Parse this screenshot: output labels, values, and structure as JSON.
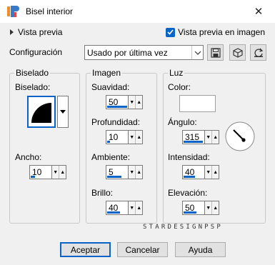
{
  "window": {
    "title": "Bisel interior",
    "close_glyph": "✕"
  },
  "top": {
    "preview_label": "Vista previa",
    "live_preview_label": "Vista previa en imagen",
    "live_preview_checked": true
  },
  "config": {
    "label": "Configuración",
    "value": "Usado por última vez"
  },
  "groups": {
    "bevel": {
      "title": "Biselado",
      "bevel_label": "Biselado:",
      "width_label": "Ancho:",
      "width_value": "10"
    },
    "image": {
      "title": "Imagen",
      "smoothness_label": "Suavidad:",
      "smoothness_value": "50",
      "depth_label": "Profundidad:",
      "depth_value": "10",
      "ambience_label": "Ambiente:",
      "ambience_value": "5",
      "brightness_label": "Brillo:",
      "brightness_value": "40"
    },
    "light": {
      "title": "Luz",
      "color_label": "Color:",
      "color_value": "#ffffff",
      "angle_label": "Ángulo:",
      "angle_value": "315",
      "intensity_label": "Intensidad:",
      "intensity_value": "40",
      "elevation_label": "Elevación:",
      "elevation_value": "50"
    }
  },
  "watermark": "STARDESIGNPSP",
  "buttons": {
    "accept": "Aceptar",
    "cancel": "Cancelar",
    "help": "Ayuda"
  },
  "colors": {
    "accent": "#0a64c8",
    "background": "#f0f0f0"
  }
}
